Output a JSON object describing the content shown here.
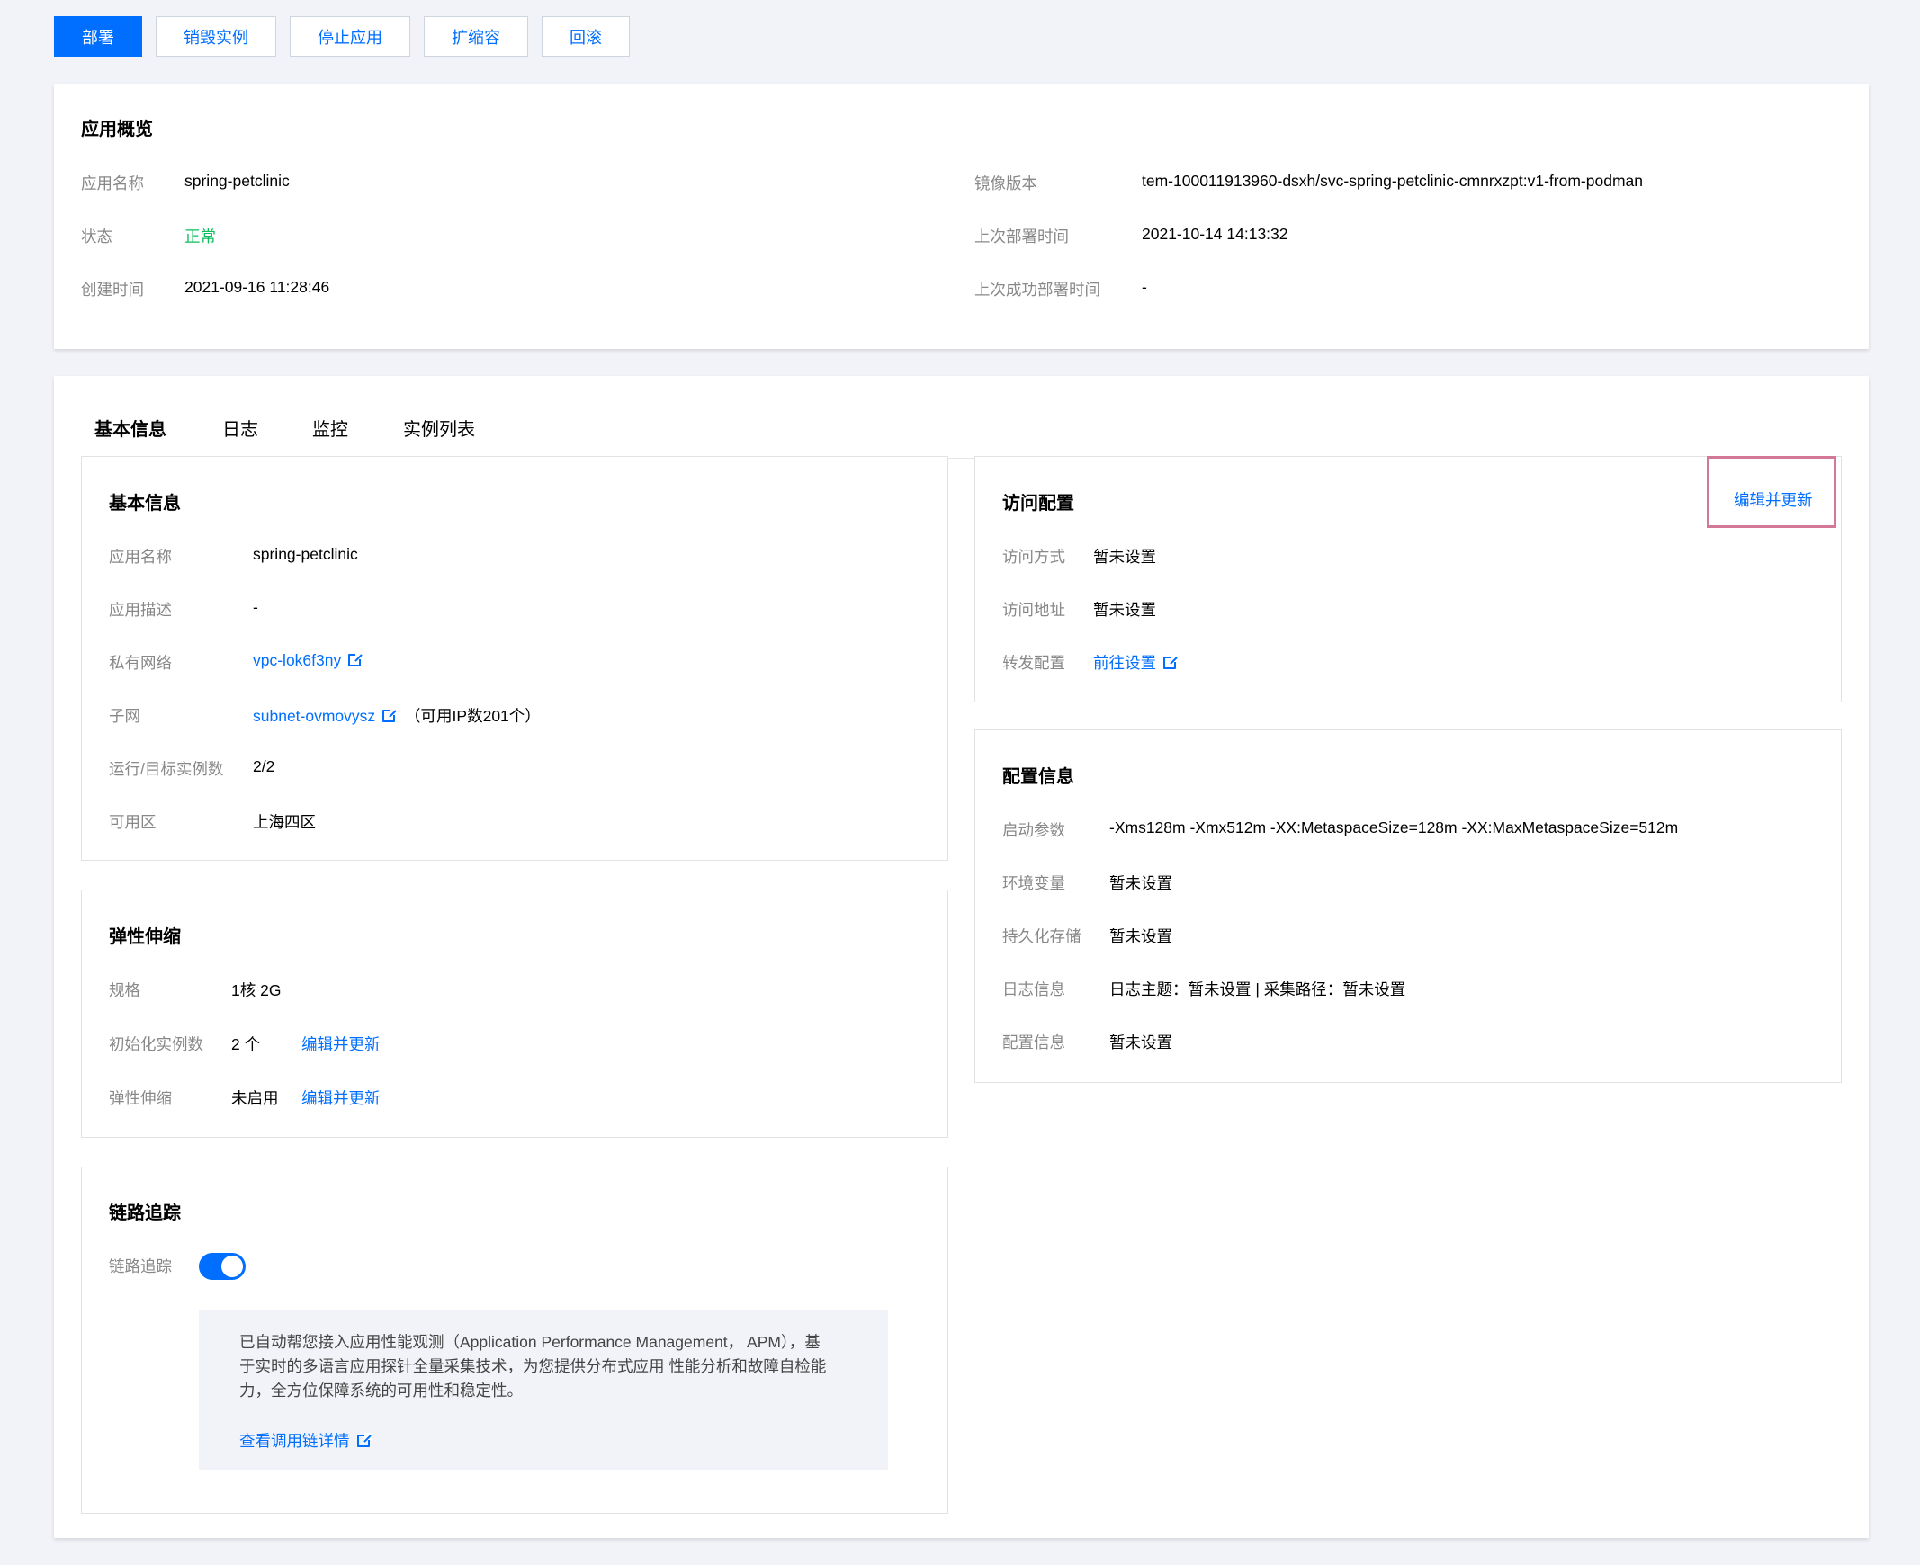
{
  "toolbar": {
    "deploy": "部署",
    "destroy": "销毁实例",
    "stop": "停止应用",
    "scale": "扩缩容",
    "rollback": "回滚"
  },
  "overview": {
    "title": "应用概览",
    "app_name_label": "应用名称",
    "app_name": "spring-petclinic",
    "status_label": "状态",
    "status": "正常",
    "created_label": "创建时间",
    "created": "2021-09-16 11:28:46",
    "image_label": "镜像版本",
    "image": "tem-100011913960-dsxh/svc-spring-petclinic-cmnrxzpt:v1-from-podman",
    "last_deploy_label": "上次部署时间",
    "last_deploy": "2021-10-14 14:13:32",
    "last_success_label": "上次成功部署时间",
    "last_success": "-"
  },
  "tabs": [
    "基本信息",
    "日志",
    "监控",
    "实例列表"
  ],
  "basic": {
    "title": "基本信息",
    "app_name_label": "应用名称",
    "app_name": "spring-petclinic",
    "desc_label": "应用描述",
    "desc": "-",
    "vpc_label": "私有网络",
    "vpc": "vpc-lok6f3ny",
    "subnet_label": "子网",
    "subnet": "subnet-ovmovysz",
    "subnet_note": "（可用IP数201个）",
    "instances_label": "运行/目标实例数",
    "instances": "2/2",
    "zone_label": "可用区",
    "zone": "上海四区"
  },
  "scaling": {
    "title": "弹性伸缩",
    "spec_label": "规格",
    "spec": "1核 2G",
    "init_label": "初始化实例数",
    "init": "2 个",
    "init_edit": "编辑并更新",
    "auto_label": "弹性伸缩",
    "auto": "未启用",
    "auto_edit": "编辑并更新"
  },
  "tracing": {
    "title": "链路追踪",
    "toggle_label": "链路追踪",
    "enabled": true,
    "desc": "已自动帮您接入应用性能观测（Application Performance Management， APM），基于实时的多语言应用探针全量采集技术，为您提供分布式应用 性能分析和故障自检能力，全方位保障系统的可用性和稳定性。",
    "link": "查看调用链详情"
  },
  "access": {
    "title": "访问配置",
    "edit": "编辑并更新",
    "method_label": "访问方式",
    "method": "暂未设置",
    "address_label": "访问地址",
    "address": "暂未设置",
    "forward_label": "转发配置",
    "forward": "前往设置"
  },
  "config": {
    "title": "配置信息",
    "startup_label": "启动参数",
    "startup": "-Xms128m -Xmx512m -XX:MetaspaceSize=128m -XX:MaxMetaspaceSize=512m",
    "env_label": "环境变量",
    "env": "暂未设置",
    "storage_label": "持久化存储",
    "storage": "暂未设置",
    "log_label": "日志信息",
    "log": "日志主题：暂未设置 | 采集路径：暂未设置",
    "cfg_label": "配置信息",
    "cfg": "暂未设置"
  }
}
